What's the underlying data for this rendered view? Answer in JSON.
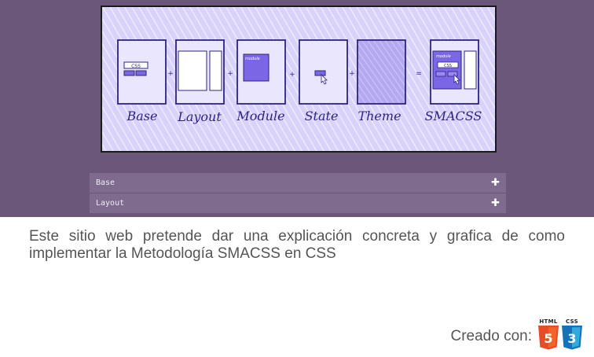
{
  "diagram": {
    "labels": [
      "Base",
      "Layout",
      "Module",
      "State",
      "Theme",
      "SMACSS"
    ],
    "operators": [
      "+",
      "+",
      "+",
      "+",
      "="
    ],
    "inner_texts": {
      "css": "CSS",
      "module": "module"
    }
  },
  "accordion": {
    "items": [
      {
        "label": "Base",
        "icon": "plus-icon"
      },
      {
        "label": "Layout",
        "icon": "plus-icon"
      }
    ]
  },
  "description": "Este sitio web pretende dar una explicación concreta y grafica de como implementar la Metodología SMACSS en CSS",
  "credits": {
    "label": "Creado con:",
    "badges": [
      {
        "text": "HTML",
        "number": "5",
        "icon": "html5-logo-icon",
        "color": "#e44d26",
        "shade": "#f16529"
      },
      {
        "text": "CSS",
        "number": "3",
        "icon": "css3-logo-icon",
        "color": "#1572b6",
        "shade": "#33a9dc"
      }
    ]
  },
  "colors": {
    "header": "#6a5779",
    "hero_bg": "#d9d3fb",
    "ink": "#2e2480",
    "module_fill": "#7b66e6",
    "accordion_item": "#7e6b8e"
  }
}
